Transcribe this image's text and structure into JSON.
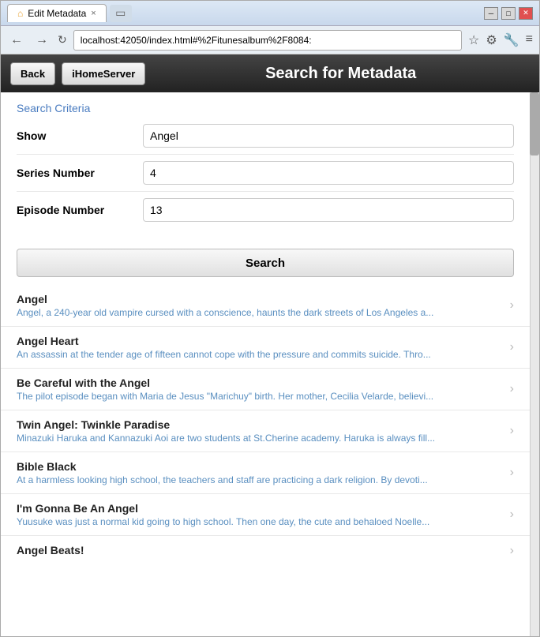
{
  "browser": {
    "title": "Edit Metadata",
    "tab_close": "×",
    "url": "localhost:42050/index.html#%2Fitunesalbum%2F8084:",
    "back_btn": "←",
    "forward_btn": "→",
    "reload_btn": "↻"
  },
  "header": {
    "back_label": "Back",
    "ihome_label": "iHomeServer",
    "title": "Search for Metadata"
  },
  "search_criteria": {
    "title": "Search Criteria",
    "fields": [
      {
        "label": "Show",
        "value": "Angel",
        "placeholder": ""
      },
      {
        "label": "Series Number",
        "value": "4",
        "placeholder": ""
      },
      {
        "label": "Episode Number",
        "value": "13",
        "placeholder": ""
      }
    ],
    "search_button_label": "Search"
  },
  "results": [
    {
      "title": "Angel",
      "description": "Angel, a 240-year old vampire cursed with a conscience, haunts the dark streets of Los Angeles a..."
    },
    {
      "title": "Angel Heart",
      "description": "An assassin at the tender age of fifteen cannot cope with the pressure and commits suicide. Thro..."
    },
    {
      "title": "Be Careful with the Angel",
      "description": "The pilot episode began with Maria de Jesus \"Marichuy\" birth. Her mother, Cecilia Velarde, believi..."
    },
    {
      "title": "Twin Angel: Twinkle Paradise",
      "description": "Minazuki Haruka and Kannazuki Aoi are two students at St.Cherine academy. Haruka is always fill..."
    },
    {
      "title": "Bible Black",
      "description": "At a harmless looking high school, the teachers and staff are practicing a dark religion. By devoti..."
    },
    {
      "title": "I'm Gonna Be An Angel",
      "description": "Yuusuke was just a normal kid going to high school. Then one day, the cute and behaloed Noelle..."
    },
    {
      "title": "Angel Beats!",
      "description": ""
    }
  ]
}
